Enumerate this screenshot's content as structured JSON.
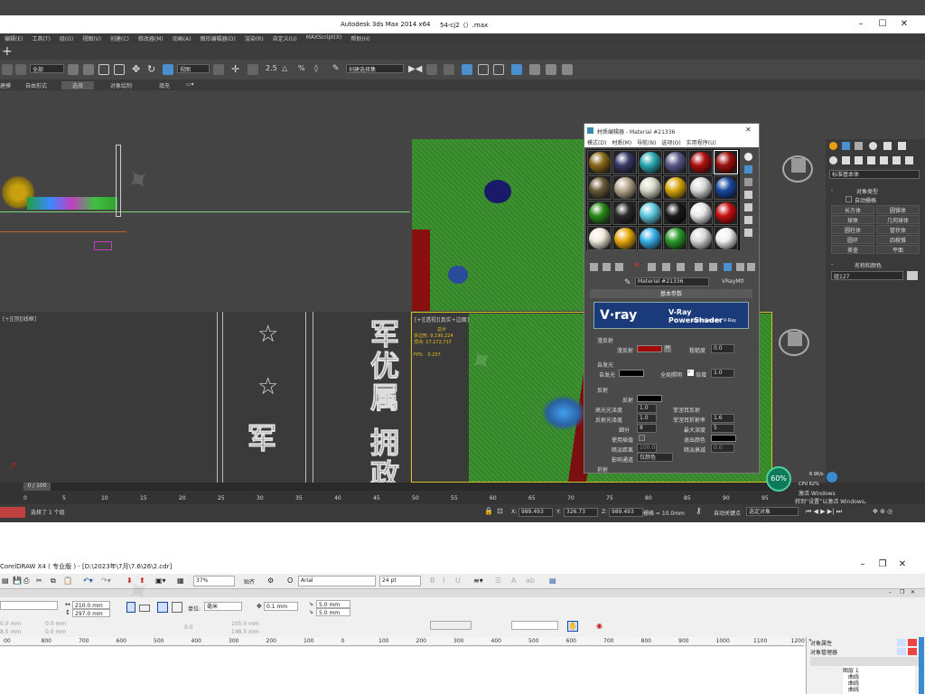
{
  "max": {
    "title_app": "Autodesk 3ds Max  2014 x64",
    "title_file": "54-cj2（）.max",
    "menu": [
      "编辑(E)",
      "工具(T)",
      "组(G)",
      "视图(V)",
      "创建(C)",
      "修改器(M)",
      "动画(A)",
      "图形编辑器(D)",
      "渲染(R)",
      "自定义(U)",
      "MAXScript(X)",
      "帮助(H)"
    ],
    "selection_filter": "全部",
    "ref_coord": "视图",
    "named_selection": "创建选择集",
    "ribbon_tabs": [
      "建模",
      "自由形式",
      "选择",
      "对象绘制",
      "填充"
    ],
    "viewport_bl_label": "[+][顶][线框]",
    "viewport_br_label": "[+][透视][真实+边面]",
    "stats": {
      "total_label": "总计",
      "poly_label": "多边形:",
      "poly_value": "9,190,224",
      "vert_label": "顶点:",
      "vert_value": "17,172,737",
      "fps_label": "FPS:",
      "fps_value": "0.257"
    },
    "timeline_frame": "0 / 100",
    "ruler_ticks": [
      "0",
      "5",
      "10",
      "15",
      "20",
      "25",
      "30",
      "35",
      "40",
      "45",
      "50",
      "55",
      "60",
      "65",
      "70",
      "75",
      "80",
      "85",
      "90",
      "95"
    ],
    "status_text": "选择了 1 个组",
    "x_label": "X:",
    "x_value": "989.493",
    "y_label": "Y:",
    "y_value": "326.73",
    "z_label": "Z:",
    "z_value": "989.493",
    "grid": "栅格 = 10.0mm",
    "auto_key": "自动关键点",
    "selected_obj": "选定对象",
    "gauge_value": "60%",
    "gauge_up": "6.9K/s",
    "gauge_cpu": "CPU 62%",
    "activate_line1": "转到“设置”以激活 Windows。",
    "activate_line2": "激活 Windows"
  },
  "medit": {
    "title": "材质编辑器 - Material #21336",
    "menu": [
      "模式(D)",
      "材质(M)",
      "导航(N)",
      "选项(O)",
      "实用程序(U)"
    ],
    "material_name": "Material #21336",
    "material_type": "VRayMtl",
    "rollout": "基本参数",
    "banner_logo": "V·ray",
    "banner_title": "V-Ray PowerShader",
    "banner_sub": "optimized for V-Ray",
    "diffuse_group": "漫反射",
    "diffuse_label": "漫反射",
    "rough_label": "粗糙度",
    "rough_value": "0.0",
    "self_illum_group": "自发光",
    "self_illum_label": "自发光",
    "gi_label": "全局照明",
    "mult_label": "倍增",
    "mult_value": "1.0",
    "reflect_group": "反射",
    "reflect_label": "反射",
    "hilight_label": "高光光泽度",
    "hilight_value": "1.0",
    "refl_gloss_label": "反射光泽度",
    "refl_gloss_value": "1.0",
    "subdiv_label": "细分",
    "subdiv_value": "8",
    "interp_label": "使用插值",
    "fresnel_label": "菲涅耳反射",
    "fresnel_ior_label": "菲涅耳折射率",
    "fresnel_ior_value": "1.6",
    "max_depth_label": "最大深度",
    "max_depth_value": "5",
    "exit_color_label": "退出颜色",
    "dim_dist_label": "暗淡距离",
    "dim_dist_value": "100.0",
    "dim_falloff_label": "暗淡衰减",
    "dim_falloff_value": "0.0",
    "affect_label": "影响通道",
    "affect_value": "仅颜色",
    "refract_group": "折射",
    "spheres": [
      "#8a6a1a",
      "#3a3a6a",
      "#2aa8b0",
      "#5a5a8a",
      "#b01010",
      "#a01010",
      "#6a5a3a",
      "#b8a890",
      "#d8d8c8",
      "#d8a810",
      "#d8d8d8",
      "#1a4aa0",
      "#2a8a1a",
      "#2a2a2a",
      "#60c8e0",
      "#1a1a1a",
      "#e8e8e8",
      "#c81010",
      "#f0ead8",
      "#e8a810",
      "#3ab0e8",
      "#2a9a2a",
      "#d8d8d8",
      "#f0f0f0"
    ]
  },
  "cmd": {
    "dropdown": "标准基本体",
    "obj_type": "对象类型",
    "autogrid": "自动栅格",
    "buttons": [
      "长方体",
      "圆锥体",
      "球体",
      "几何球体",
      "圆柱体",
      "管状体",
      "圆环",
      "四棱锥",
      "茶壶",
      "平面"
    ],
    "name_color": "名称和颜色",
    "name_value": "组127"
  },
  "cdr": {
    "title": "CorelDRAW X4 ( 专业版 ) - [D:\\2023年\\7月\\7.6\\26\\2.cdr]",
    "zoom": "37%",
    "snap": "贴齐",
    "font": "Arial",
    "font_size": "24 pt",
    "width_value": "210.0 mm",
    "height_value": "297.0 mm",
    "unit_label": "单位:",
    "unit_value": "毫米",
    "nudge": "0.1 mm",
    "dup_x": "5.0 mm",
    "dup_y": "5.0 mm",
    "pos_x": "0.0 mm",
    "pos_y": "0.0 mm",
    "angle": "0.0",
    "size_x": "105.0 mm",
    "size_y": "148.5 mm",
    "dim1": "0.0 mm",
    "dim2": "8.5 mm",
    "ruler_ticks": [
      "00",
      "800",
      "700",
      "600",
      "500",
      "400",
      "300",
      "200",
      "100",
      "0",
      "100",
      "200",
      "300",
      "400",
      "500",
      "600",
      "700",
      "800",
      "900",
      "1000",
      "1100",
      "1200"
    ],
    "dock_props": "对象属性",
    "dock_mgr": "对象管理器",
    "tree": [
      "图层 1",
      "曲线",
      "曲线",
      "曲线"
    ]
  }
}
